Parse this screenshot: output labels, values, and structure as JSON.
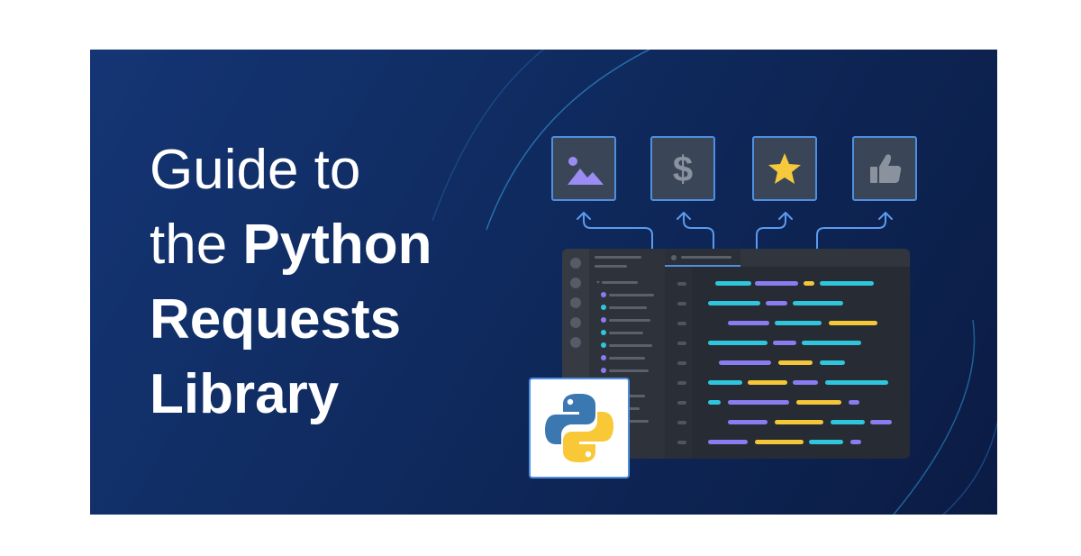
{
  "headline": {
    "line1": "Guide to",
    "line2_light": "the ",
    "line2_bold": "Python",
    "line3": "Requests",
    "line4": "Library"
  },
  "tiles": [
    {
      "icon": "image-icon"
    },
    {
      "icon": "dollar-icon",
      "glyph": "$"
    },
    {
      "icon": "star-icon"
    },
    {
      "icon": "thumbs-up-icon"
    }
  ],
  "colors": {
    "background": "#143574",
    "tile_border": "#4f8fe0",
    "connector": "#5b9bef",
    "code_cyan": "#2fc6dd",
    "code_purple": "#8a7cf0",
    "code_yellow": "#f3c738",
    "python_blue": "#3b77b0",
    "python_yellow": "#f8c837"
  },
  "logo": {
    "icon": "python-logo-icon"
  }
}
